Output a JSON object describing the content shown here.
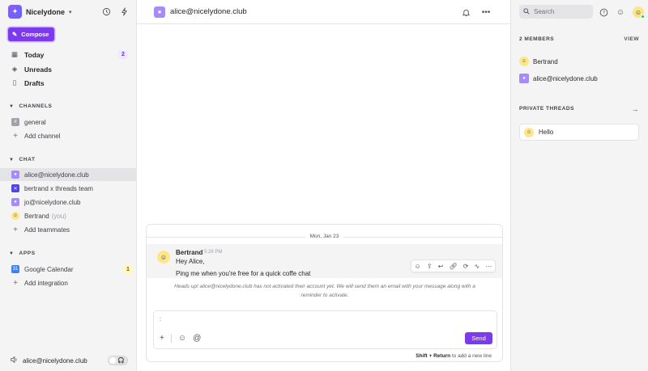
{
  "workspace": {
    "name": "Nicelydone",
    "logo_icon": "sparkle-icon"
  },
  "sidebar": {
    "compose_label": "Compose",
    "nav": [
      {
        "label": "Today",
        "icon": "calendar-icon",
        "badge": "2"
      },
      {
        "label": "Unreads",
        "icon": "layers-icon"
      },
      {
        "label": "Drafts",
        "icon": "file-icon"
      }
    ],
    "channels": {
      "header": "CHANNELS",
      "items": [
        {
          "label": "general"
        }
      ],
      "add_label": "Add channel"
    },
    "chat": {
      "header": "CHAT",
      "items": [
        {
          "label": "alice@nicelydone.club",
          "active": true
        },
        {
          "label": "bertrand x threads team"
        },
        {
          "label": "jo@nicelydone.club"
        },
        {
          "label": "Bertrand",
          "suffix": "(you)"
        }
      ],
      "add_label": "Add teammates"
    },
    "apps": {
      "header": "APPS",
      "items": [
        {
          "label": "Google Calendar",
          "badge": "1"
        }
      ],
      "add_label": "Add integration"
    },
    "footer": {
      "label": "alice@nicelydone.club"
    }
  },
  "main": {
    "title": "alice@nicelydone.club",
    "day_label": "Mon, Jan 23",
    "message": {
      "author": "Bertrand",
      "time": "5:28 PM",
      "line1": "Hey Alice,",
      "line2": "Ping me when you're free for a quick coffe chat"
    },
    "notice_line1": "Heads up! alice@nicelydone.club has not activated their account yet. We will send them an email with your message along with a",
    "notice_line2": "reminder to activate.",
    "composer": {
      "caret": ":",
      "send_label": "Send"
    },
    "hint_keys": "Shift + Return",
    "hint_text": " to add a new line"
  },
  "right": {
    "search_placeholder": "Search",
    "members_header": "2 MEMBERS",
    "view_label": "VIEW",
    "members": [
      {
        "name": "Bertrand"
      },
      {
        "name": "alice@nicelydone.club"
      }
    ],
    "threads_header": "PRIVATE THREADS",
    "thread": {
      "title": "Hello"
    }
  },
  "colors": {
    "accent": "#7c3aed",
    "sidebar_bg": "#f4f4f5"
  }
}
